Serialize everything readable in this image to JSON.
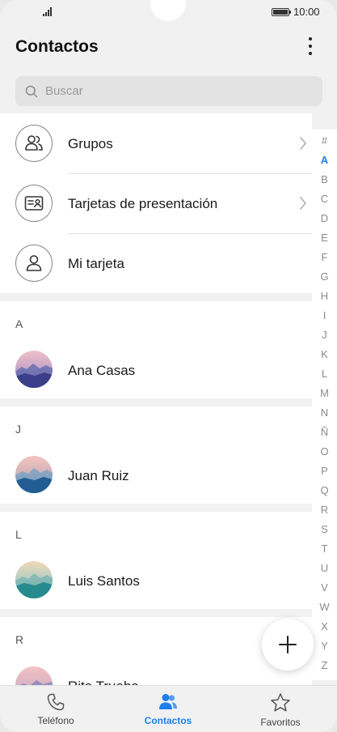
{
  "status_bar": {
    "time": "10:00",
    "battery": "full",
    "signal": "4-bars"
  },
  "header": {
    "title": "Contactos",
    "menu_icon": "more-vertical-icon"
  },
  "search": {
    "placeholder": "Buscar"
  },
  "shortcuts": [
    {
      "label": "Grupos",
      "icon": "group-icon",
      "has_chevron": true
    },
    {
      "label": "Tarjetas de presentación",
      "icon": "business-card-icon",
      "has_chevron": true
    },
    {
      "label": "Mi tarjeta",
      "icon": "person-icon",
      "has_chevron": false
    }
  ],
  "sections": [
    {
      "letter": "A",
      "contacts": [
        {
          "name": "Ana Casas",
          "avatar": "landscape-purple"
        }
      ]
    },
    {
      "letter": "J",
      "contacts": [
        {
          "name": "Juan Ruiz",
          "avatar": "landscape-blue"
        }
      ]
    },
    {
      "letter": "L",
      "contacts": [
        {
          "name": "Luis Santos",
          "avatar": "landscape-teal"
        }
      ]
    },
    {
      "letter": "R",
      "contacts": [
        {
          "name": "Rita Trueba",
          "avatar": "landscape-pink"
        }
      ]
    }
  ],
  "alphabet_index": [
    "#",
    "A",
    "B",
    "C",
    "D",
    "E",
    "F",
    "G",
    "H",
    "I",
    "J",
    "K",
    "L",
    "M",
    "N",
    "Ñ",
    "O",
    "P",
    "Q",
    "R",
    "S",
    "T",
    "U",
    "V",
    "W",
    "X",
    "Y",
    "Z"
  ],
  "alphabet_active": "A",
  "fab": {
    "icon": "plus-icon"
  },
  "bottom_nav": [
    {
      "label": "Teléfono",
      "icon": "phone-icon",
      "active": false
    },
    {
      "label": "Contactos",
      "icon": "contacts-icon",
      "active": true
    },
    {
      "label": "Favoritos",
      "icon": "star-icon",
      "active": false
    }
  ],
  "colors": {
    "accent": "#1d7ff0",
    "background": "#f1f1f1",
    "surface": "#ffffff"
  }
}
